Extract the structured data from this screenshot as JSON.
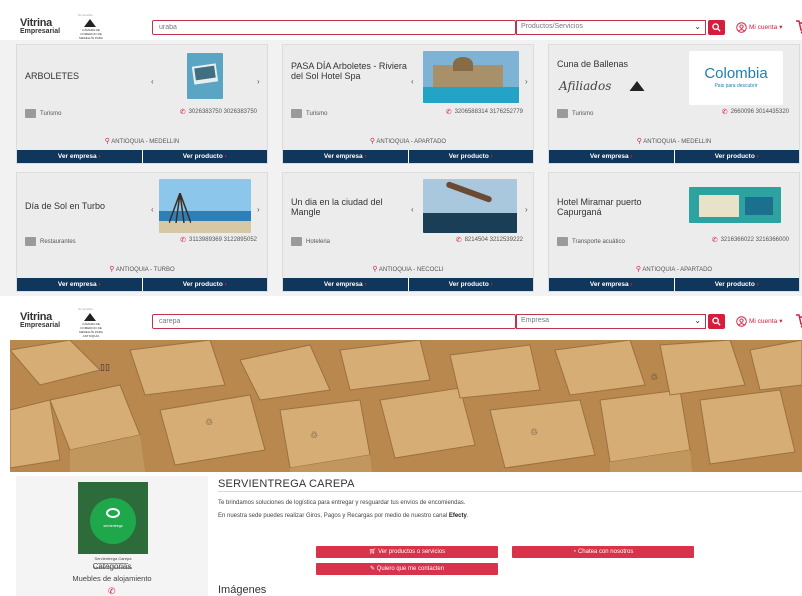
{
  "header_top": {
    "logo_line1": "Vitrina",
    "logo_line2": "Empresarial",
    "camara_top": "Un servicio",
    "camara_text": "CÁMARA DE COMERCIO DE MEDELLÍN PARA ANTIOQUIA",
    "search_value": "uraba",
    "category_value": "Productos/Servicios",
    "account_label": "Mi cuenta"
  },
  "header_bottom": {
    "logo_line1": "Vitrina",
    "logo_line2": "Empresarial",
    "camara_top": "Un servicio",
    "camara_text": "CÁMARA DE COMERCIO DE MEDELLÍN PARA ANTIOQUIA",
    "search_value": "carepa",
    "category_value": "Empresa",
    "account_label": "Mi cuenta"
  },
  "buttons": {
    "ver_empresa": "Ver empresa",
    "ver_producto": "Ver producto"
  },
  "cards": [
    {
      "title": "ARBOLETES",
      "sector": "Turismo",
      "phone": "3026383750 3026383750",
      "location": "ANTIOQUIA - MEDELLIN"
    },
    {
      "title": "PASA DÍA Arboletes - Riviera del Sol Hotel Spa",
      "sector": "Turismo",
      "phone": "3206588314 3176252779",
      "location": "ANTIOQUIA - APARTADO"
    },
    {
      "title": "Cuna de Ballenas",
      "sector": "Turismo",
      "phone": "2660096 3014435320",
      "location": "ANTIOQUIA - MEDELLIN",
      "logo_text": "Colombia",
      "logo_sub": "Pais para descubrir"
    },
    {
      "title": "Día de Sol en Turbo",
      "sector": "Restaurantes",
      "phone": "3113989369 3122895052",
      "location": "ANTIOQUIA - TURBO"
    },
    {
      "title": "Un dia en la ciudad del Mangle",
      "sector": "Hoteleria",
      "phone": "8214504 3212539222",
      "location": "ANTIOQUIA - NECOCLI"
    },
    {
      "title": "Hotel Miramar puerto Capurganá",
      "sector": "Transporte acuático",
      "phone": "3216366022 3216366000",
      "location": "ANTIOQUIA - APARTADO"
    }
  ],
  "profile": {
    "company_name": "SERVIENTREGA CAREPA",
    "desc1": "Te brindamos soluciones de logística para entregar y resguardar tus envíos de encomiendas.",
    "desc2_prefix": "En nuestra sede puedes realizar Giros, Pagos y Recargas por medio de nuestro canal",
    "desc2_bold": "Efecty",
    "desc2_suffix": ".",
    "logo_circle_text": "servientrega",
    "logo_caption1": "Servientrega Carepa",
    "logo_caption2": "Mundo de Soluciones",
    "categories_label": "Categorias",
    "categories_value": "Muebles de alojamiento",
    "btn_products": "Ver productos o servicios",
    "btn_chat": "Chatea con nosotros",
    "btn_contact": "Quiero que me contacten",
    "images_heading": "Imágenes"
  },
  "colors": {
    "brand_red": "#d51e3d",
    "navy": "#10375b"
  }
}
